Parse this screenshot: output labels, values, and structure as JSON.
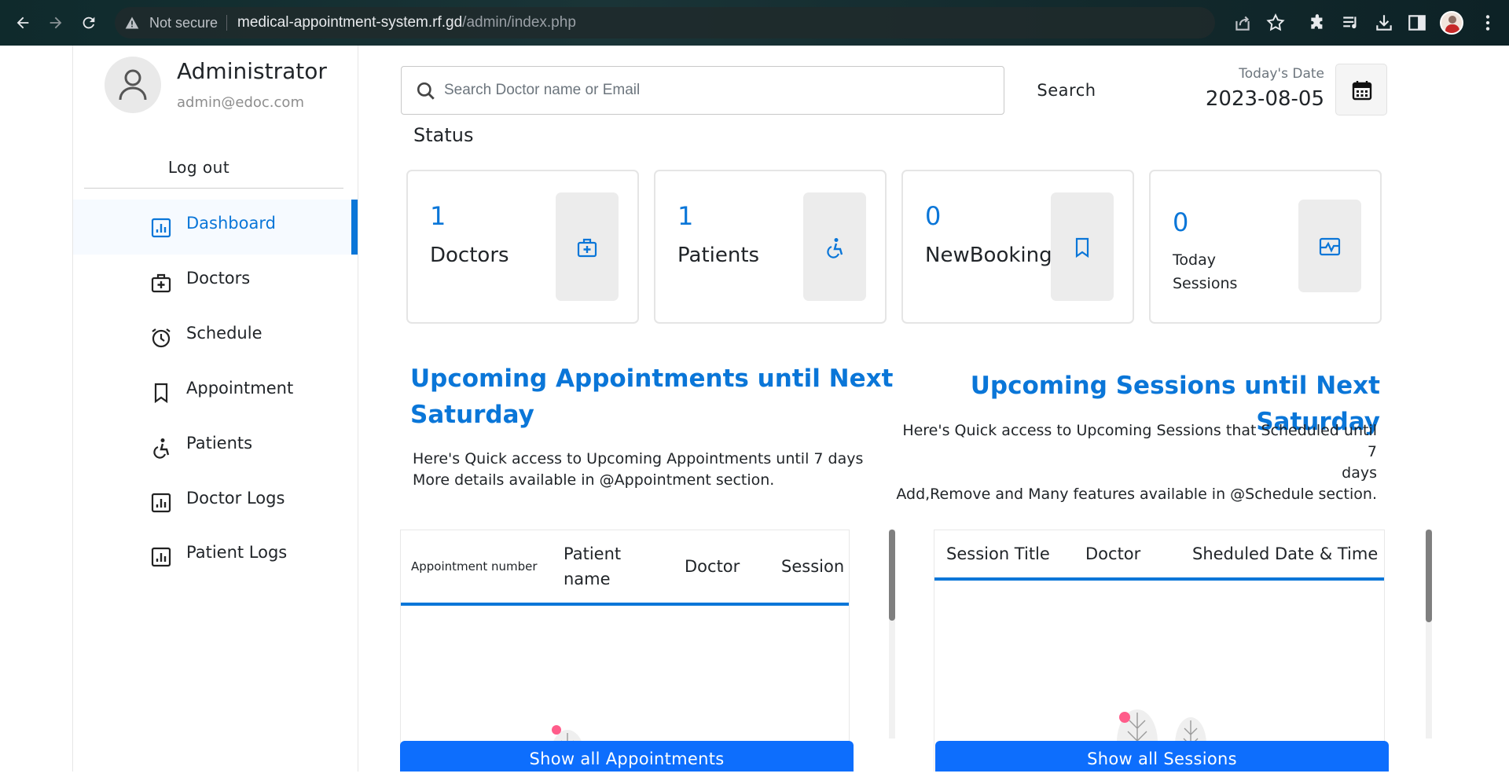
{
  "browser": {
    "security_label": "Not secure",
    "url_host": "medical-appointment-system.rf.gd",
    "url_path": "/admin/index.php"
  },
  "sidebar": {
    "admin_name": "Administrator",
    "admin_email": "admin@edoc.com",
    "logout_label": "Log out",
    "items": [
      {
        "label": "Dashboard",
        "icon": "dashboard-icon",
        "active": true
      },
      {
        "label": "Doctors",
        "icon": "doctors-icon"
      },
      {
        "label": "Schedule",
        "icon": "schedule-icon"
      },
      {
        "label": "Appointment",
        "icon": "appointment-icon"
      },
      {
        "label": "Patients",
        "icon": "patients-icon"
      },
      {
        "label": "Doctor Logs",
        "icon": "doctor-logs-icon"
      },
      {
        "label": "Patient Logs",
        "icon": "patient-logs-icon"
      }
    ]
  },
  "header": {
    "search_placeholder": "Search Doctor name or Email",
    "search_button": "Search",
    "date_label": "Today's Date",
    "date_value": "2023-08-05"
  },
  "status": {
    "title": "Status",
    "cards": [
      {
        "count": "1",
        "label": "Doctors",
        "icon": "doctor-bag-icon"
      },
      {
        "count": "1",
        "label": "Patients",
        "icon": "patient-icon"
      },
      {
        "count": "0",
        "label": "NewBooking",
        "icon": "bookmark-icon"
      },
      {
        "count": "0",
        "label_line1": "Today",
        "label_line2": "Sessions",
        "icon": "session-pulse-icon"
      }
    ]
  },
  "appointments": {
    "title_line1": "Upcoming Appointments until Next",
    "title_line2": "Saturday",
    "desc_line1": "Here's Quick access to Upcoming Appointments until 7 days",
    "desc_line2": "More details available in @Appointment section.",
    "columns": {
      "number": "Appointment number",
      "patient_line1": "Patient",
      "patient_line2": "name",
      "doctor": "Doctor",
      "session": "Session"
    },
    "button": "Show all Appointments"
  },
  "sessions": {
    "title": "Upcoming Sessions until Next Saturday",
    "desc_line1": "Here's Quick access to Upcoming Sessions that Scheduled until 7",
    "desc_line2": "days",
    "desc_line3": "Add,Remove and Many features available in @Schedule section.",
    "columns": {
      "title": "Session Title",
      "doctor": "Doctor",
      "datetime": "Sheduled Date & Time"
    },
    "button": "Show all Sessions"
  },
  "colors": {
    "accent": "#0a76d8",
    "button": "#0d6efd"
  }
}
